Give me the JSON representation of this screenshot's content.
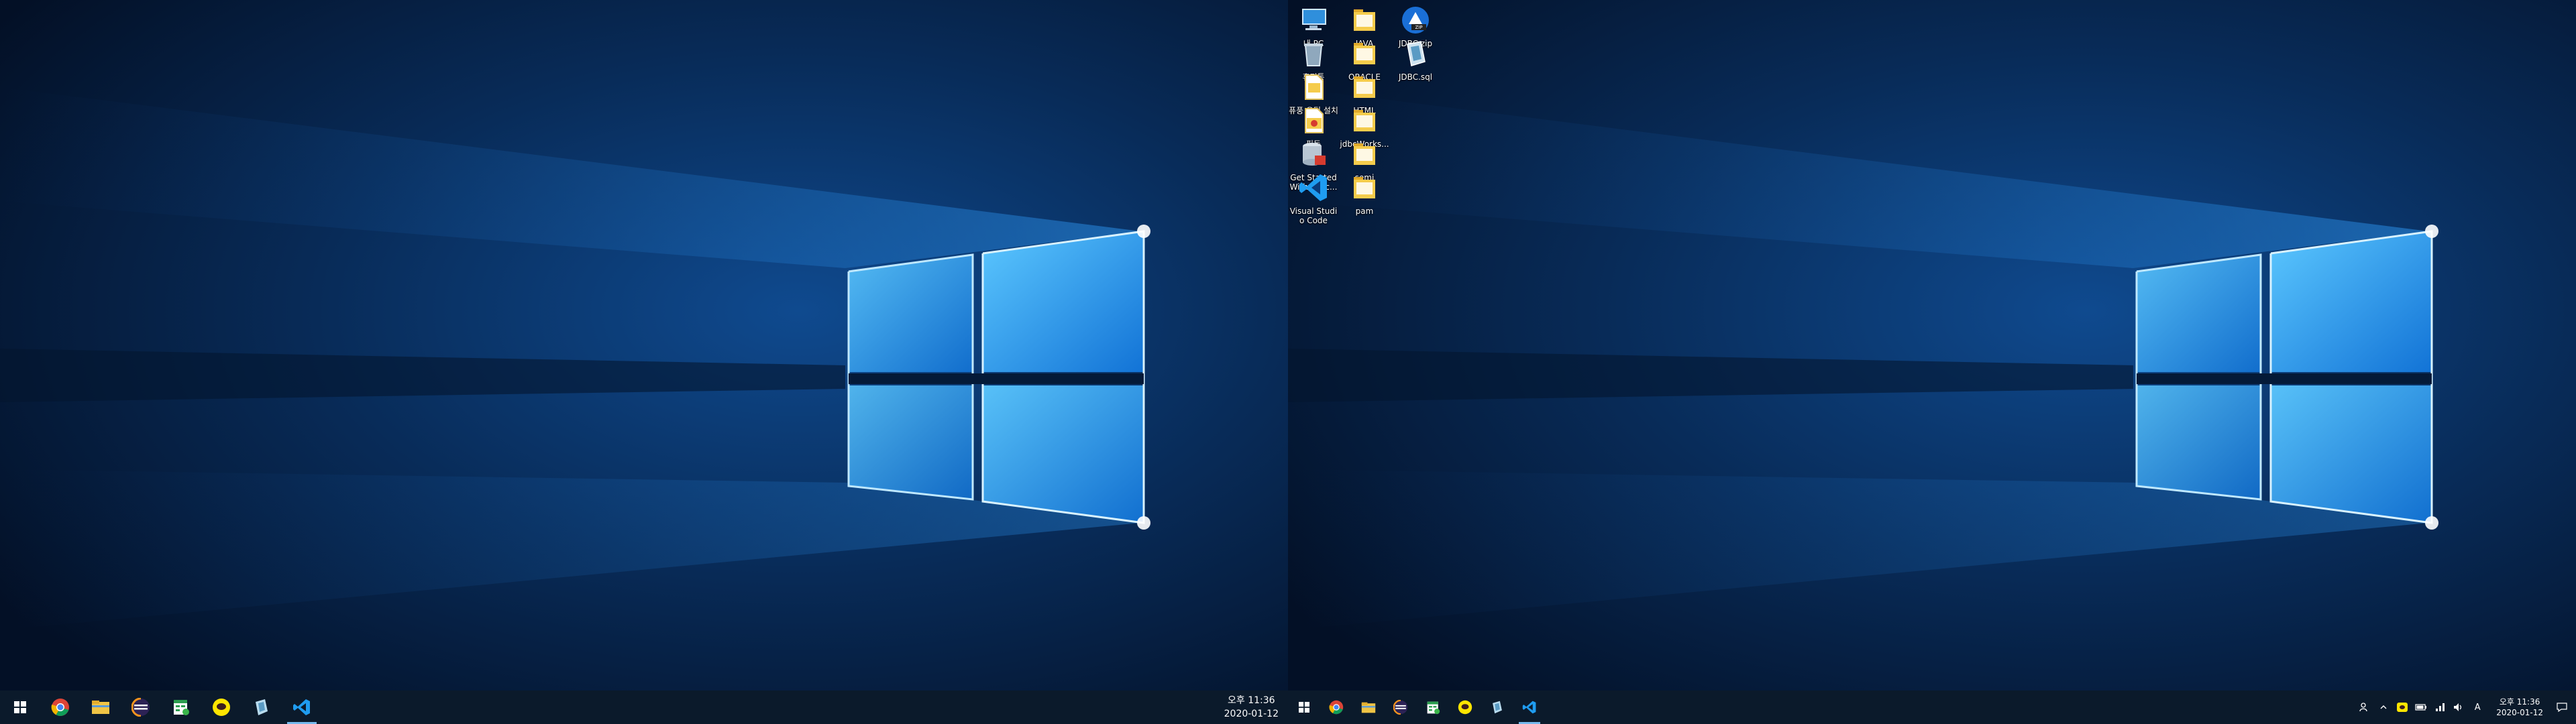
{
  "desktop_icons": [
    {
      "label": "내 PC",
      "icon": "this-pc-icon"
    },
    {
      "label": "JAVA",
      "icon": "folder-icon"
    },
    {
      "label": "JDBC.zip",
      "icon": "zip-archive-icon"
    },
    {
      "label": "휴지통",
      "icon": "recycle-bin-icon"
    },
    {
      "label": "ORACLE",
      "icon": "folder-icon"
    },
    {
      "label": "JDBC.sql",
      "icon": "sql-file-icon"
    },
    {
      "label": "퓨풍 유틸 설치",
      "icon": "shortcut-file-icon"
    },
    {
      "label": "HTML",
      "icon": "folder-icon"
    },
    {
      "label": "필독",
      "icon": "pdf-file-icon"
    },
    {
      "label": "jdbcWorks...",
      "icon": "folder-icon"
    },
    {
      "label": "Get Started With Orac...",
      "icon": "oracle-database-icon"
    },
    {
      "label": "semi",
      "icon": "folder-icon"
    },
    {
      "label": "Visual Studio Code",
      "icon": "vscode-icon"
    },
    {
      "label": "pam",
      "icon": "folder-icon"
    }
  ],
  "taskbar": {
    "apps": [
      "chrome-icon",
      "file-explorer-icon",
      "eclipse-icon",
      "spreadsheet-icon",
      "kakaotalk-icon",
      "sql-developer-icon",
      "vscode-icon"
    ],
    "active_app": "vscode-icon",
    "clock": {
      "time": "오후 11:36",
      "date": "2020-01-12"
    },
    "ime_label": "A"
  },
  "secondary_taskbar": {
    "clock": {
      "time": "오후 11:36",
      "date": "2020-01-12"
    },
    "ime_label": "A"
  },
  "colors": {
    "taskbar_bg": "#0b1a2b",
    "accent": "#76b9ed",
    "wallpaper_glow": "#38a8ff"
  }
}
